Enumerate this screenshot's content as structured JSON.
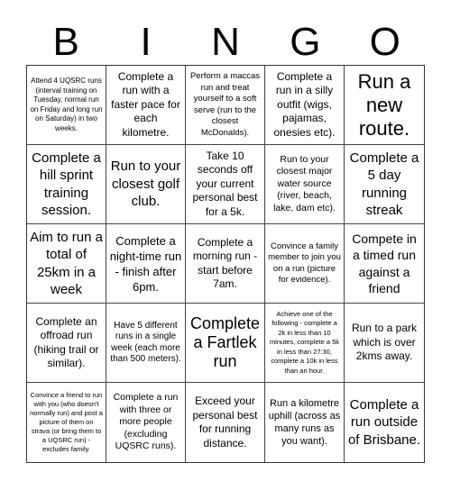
{
  "header": {
    "letters": [
      "B",
      "I",
      "N",
      "G",
      "O"
    ]
  },
  "board": {
    "cells": [
      "Attend 4 UQSRC runs (interval training on Tuesday, normal run on Friday and long run on Saturday) in two weeks.",
      "Complete a run with a faster pace for each kilometre.",
      "Perform a maccas run and treat yourself to a soft serve (run to the closest McDonalds).",
      "Complete a run in a silly outfit (wigs, pajamas, onesies etc).",
      "Run a new route.",
      "Complete a hill sprint training session.",
      "Run to your closest golf club.",
      "Take 10 seconds off your current personal best for a 5k.",
      "Run to your closest major water source (river, beach, lake, dam etc).",
      "Complete a 5 day running streak",
      "Aim to run a total of 25km in a week",
      "Complete a night-time run - finish after 6pm.",
      "Complete a morning run - start before 7am.",
      "Convince a family member to join you on a run (picture for evidence).",
      "Compete in a timed run against a friend",
      "Complete an offroad run (hiking trail or similar).",
      "Have 5 different runs in a single week (each more than 500 meters).",
      "Complete a Fartlek run",
      "Achieve one of the following - complete a 2k in less than 10 minutes, complete a 5k in less than 27:30, complete a 10k in less than an hour.",
      "Run to a park which is over 2kms away.",
      "Convince a friend to run with you (who doesn't normally run) and post a picture of them on strava (or bring them to a UQSRC run) - excludes family.",
      "Complete a run with three or more people (excluding UQSRC runs).",
      "Exceed your personal best for running distance.",
      "Run a kilometre uphill (across as many runs as you want).",
      "Complete a run outside of Brisbane."
    ]
  }
}
